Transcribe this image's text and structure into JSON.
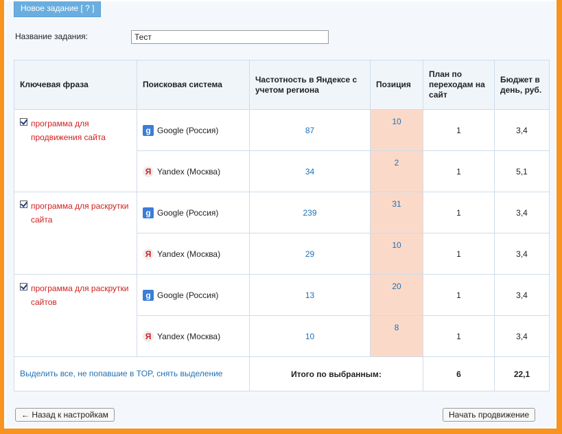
{
  "tab": {
    "label": "Новое задание [ ? ]"
  },
  "task": {
    "label": "Название задания:",
    "value": "Тест"
  },
  "headers": {
    "keyword": "Ключевая фраза",
    "engine": "Поисковая система",
    "frequency": "Частотность в Яндексе с учетом региона",
    "position": "Позиция",
    "plan": "План по переходам на сайт",
    "budget": "Бюджет в день, руб."
  },
  "groups": [
    {
      "keyword": "программа для продвижения сайта",
      "rows": [
        {
          "engine": "Google (Россия)",
          "icon": "google-icon",
          "frequency": "87",
          "position": "10",
          "plan": "1",
          "budget": "3,4"
        },
        {
          "engine": "Yandex (Москва)",
          "icon": "yandex-icon",
          "frequency": "34",
          "position": "2",
          "plan": "1",
          "budget": "5,1"
        }
      ]
    },
    {
      "keyword": "программа для раскрутки сайта",
      "rows": [
        {
          "engine": "Google (Россия)",
          "icon": "google-icon",
          "frequency": "239",
          "position": "31",
          "plan": "1",
          "budget": "3,4"
        },
        {
          "engine": "Yandex (Москва)",
          "icon": "yandex-icon",
          "frequency": "29",
          "position": "10",
          "plan": "1",
          "budget": "3,4"
        }
      ]
    },
    {
      "keyword": "программа для раскрутки сайтов",
      "rows": [
        {
          "engine": "Google (Россия)",
          "icon": "google-icon",
          "frequency": "13",
          "position": "20",
          "plan": "1",
          "budget": "3,4"
        },
        {
          "engine": "Yandex (Москва)",
          "icon": "yandex-icon",
          "frequency": "10",
          "position": "8",
          "plan": "1",
          "budget": "3,4"
        }
      ]
    }
  ],
  "footer": {
    "select_all": "Выделить все,",
    "not_in_top": "не попавшие в TOP,",
    "deselect": "снять выделение",
    "total_label": "Итого по выбранным:",
    "total_plan": "6",
    "total_budget": "22,1"
  },
  "buttons": {
    "back": "← Назад к настройкам",
    "start": "Начать продвижение"
  },
  "colors": {
    "frame": "#f7931e",
    "position_bg": "#fbd9c9",
    "keyword_text": "#d0201f",
    "link": "#1f6fb2"
  }
}
